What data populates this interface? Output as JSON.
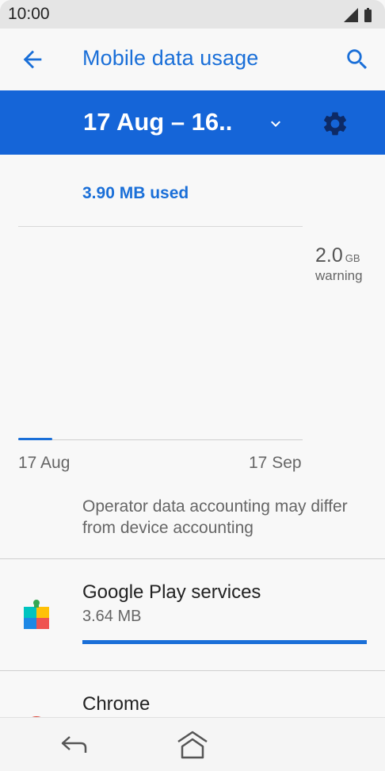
{
  "status_bar": {
    "time": "10:00",
    "icons": [
      "signal-icon",
      "battery-icon"
    ]
  },
  "header": {
    "title": "Mobile data usage",
    "back_icon": "back-arrow-icon",
    "search_icon": "search-icon"
  },
  "cycle": {
    "label": "17 Aug – 16..",
    "dropdown_icon": "chevron-down-icon",
    "settings_icon": "gear-icon"
  },
  "usage": {
    "summary": "3.90 MB used"
  },
  "chart": {
    "warning_value": "2.0",
    "warning_unit": "GB",
    "warning_label": "warning",
    "x_start": "17 Aug",
    "x_end": "17 Sep",
    "used_fraction": 0.12
  },
  "note": "Operator data accounting may differ from device accounting",
  "apps": [
    {
      "name": "Google Play services",
      "size": "3.64 MB",
      "icon": "google-play-services-icon",
      "usage_fraction": 1.0
    },
    {
      "name": "Chrome",
      "size": "",
      "icon": "chrome-icon",
      "usage_fraction": 0
    }
  ],
  "nav": {
    "back_icon": "nav-back-icon",
    "home_icon": "nav-home-icon"
  },
  "colors": {
    "accent": "#1a6fd8",
    "cycle_bar": "#1565d8",
    "background": "#f8f8f8"
  }
}
